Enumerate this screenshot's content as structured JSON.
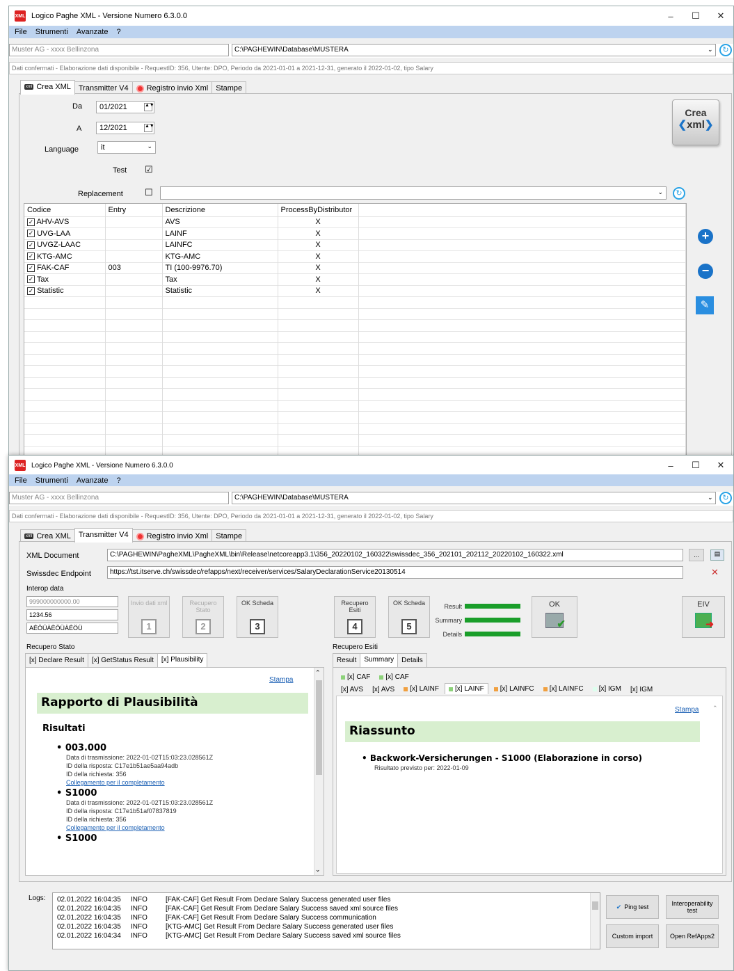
{
  "app": {
    "title": "Logico Paghe XML - Versione Numero 6.3.0.0",
    "menu": [
      "File",
      "Strumenti",
      "Avanzate",
      "?"
    ],
    "company": "Muster AG - xxxx Bellinzona",
    "db_path": "C:\\PAGHEWIN\\Database\\MUSTERA",
    "status": "Dati confermati - Elaborazione dati disponibile - RequestID: 356, Utente: DPO, Periodo da 2021-01-01 a 2021-12-31, generato il 2022-01-02, tipo Salary",
    "window_controls": [
      "–",
      "☐",
      "✕"
    ]
  },
  "tabs": [
    "Crea XML",
    "Transmitter V4",
    "Registro invio Xml",
    "Stampe"
  ],
  "crea": {
    "da_label": "Da",
    "da_value": "01/2021",
    "a_label": "A",
    "a_value": "12/2021",
    "language_label": "Language",
    "language_value": "it",
    "test_label": "Test",
    "test_checked": "☑",
    "replacement_label": "Replacement",
    "replacement_checked": "☐",
    "crea_btn_line1": "Crea",
    "crea_btn_line2": "xml",
    "columns": [
      "Codice",
      "Entry",
      "Descrizione",
      "ProcessByDistributor"
    ],
    "rows": [
      {
        "code": "AHV-AVS",
        "entry": "",
        "desc": "AVS",
        "proc": "X"
      },
      {
        "code": "UVG-LAA",
        "entry": "",
        "desc": "LAINF",
        "proc": "X"
      },
      {
        "code": "UVGZ-LAAC",
        "entry": "",
        "desc": "LAINFC",
        "proc": "X"
      },
      {
        "code": "KTG-AMC",
        "entry": "",
        "desc": "KTG-AMC",
        "proc": "X"
      },
      {
        "code": "FAK-CAF",
        "entry": "003",
        "desc": "TI (100-9976.70)",
        "proc": "X"
      },
      {
        "code": "Tax",
        "entry": "",
        "desc": "Tax",
        "proc": "X"
      },
      {
        "code": "Statistic",
        "entry": "",
        "desc": "Statistic",
        "proc": "X"
      }
    ]
  },
  "transmitter": {
    "xml_doc_label": "XML Document",
    "xml_doc_value": "C:\\PAGHEWIN\\PagheXML\\PagheXML\\bin\\Release\\netcoreapp3.1\\356_20220102_160322\\swissdec_356_202101_202112_20220102_160322.xml",
    "endpoint_label": "Swissdec Endpoint",
    "endpoint_value": "https://tst.itserve.ch/swissdec/refapps/next/receiver/services/SalaryDeclarationService20130514",
    "interop_label": "Interop data",
    "interop_1": "999000000000.00",
    "interop_2": "1234.56",
    "interop_3": "AÉÖÜÀÈÖÜÀÉÖÜ",
    "step1_label": "Invio dati xml",
    "step1_num": "1",
    "step2_label": "Recupero Stato",
    "step2_num": "2",
    "step3_label": "OK Scheda",
    "step3_num": "3",
    "step4_label": "Recupero Esiti",
    "step4_num": "4",
    "step5_label": "OK Scheda",
    "step5_num": "5",
    "result_label": "Result",
    "summary_label": "Summary",
    "details_label": "Details",
    "ok_label": "OK",
    "eiv_label": "EIV",
    "dots_btn": "...",
    "recupero_stato_label": "Recupero Stato",
    "stato_tabs": [
      "[x] Declare Result",
      "[x] GetStatus Result",
      "[x] Plausibility"
    ],
    "stampa": "Stampa",
    "plaus_title": "Rapporto di Plausibilità",
    "risultati": "Risultati",
    "entries": [
      {
        "code": "003.000",
        "lines": [
          "Data di trasmissione: 2022-01-02T15:03:23.028561Z",
          "ID della risposta: C17e1b51ae5aa94adb",
          "ID della richiesta: 356"
        ],
        "link": "Collegamento per il completamento"
      },
      {
        "code": "S1000",
        "lines": [
          "Data di trasmissione: 2022-01-02T15:03:23.028561Z",
          "ID della risposta: C17e1b51af07837819",
          "ID della richiesta: 356"
        ],
        "link": "Collegamento per il completamento"
      },
      {
        "code": "S1000",
        "lines": [],
        "link": ""
      }
    ],
    "recupero_esiti_label": "Recupero Esiti",
    "esiti_tabs": [
      "Result",
      "Summary",
      "Details"
    ],
    "esiti_row1": [
      "[x] CAF",
      "[x] CAF"
    ],
    "esiti_row2": [
      "[x] AVS",
      "[x] AVS",
      "[x] LAINF",
      "[x] LAINF",
      "[x] LAINFC",
      "[x] LAINFC",
      "[x] IGM",
      "[x] IGM"
    ],
    "riassunto_title": "Riassunto",
    "riassunto_item": "Backwork-Versicherungen - S1000 (Elaborazione in corso)",
    "riassunto_sub": "Risultato previsto per: 2022-01-09",
    "logs_label": "Logs:",
    "logs": [
      {
        "ts": "02.01.2022 16:04:35",
        "lvl": "INFO",
        "msg": "[FAK-CAF] Get Result From Declare Salary Success generated user files"
      },
      {
        "ts": "02.01.2022 16:04:35",
        "lvl": "INFO",
        "msg": "[FAK-CAF] Get Result From Declare Salary Success saved xml source files"
      },
      {
        "ts": "02.01.2022 16:04:35",
        "lvl": "INFO",
        "msg": "[FAK-CAF] Get Result From Declare Salary Success communication"
      },
      {
        "ts": "02.01.2022 16:04:35",
        "lvl": "INFO",
        "msg": "[KTG-AMC] Get Result From Declare Salary Success generated user files"
      },
      {
        "ts": "02.01.2022 16:04:34",
        "lvl": "INFO",
        "msg": "[KTG-AMC] Get Result From Declare Salary Success saved xml source files"
      }
    ],
    "ping_btn": "Ping test",
    "interop_btn": "Interoperability test",
    "custom_btn": "Custom import",
    "refapps_btn": "Open RefApps2"
  },
  "colors": {
    "accent": "#1a73c8",
    "menubar": "#bdd3ef",
    "green": "#1a9e2a",
    "report_head": "#d8efcf"
  }
}
